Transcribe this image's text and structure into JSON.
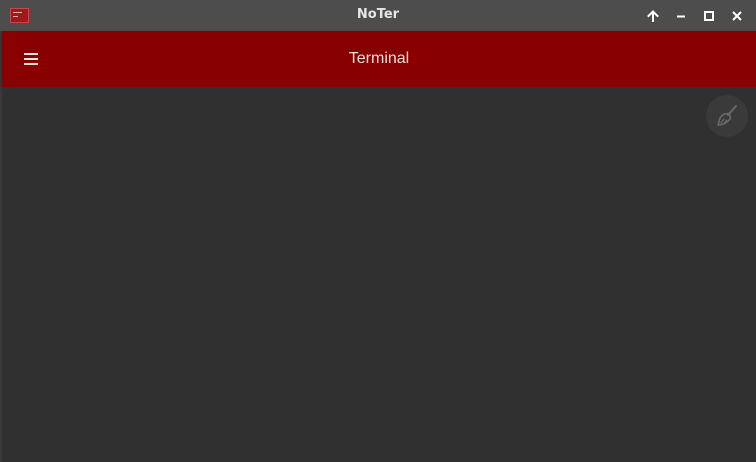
{
  "window": {
    "title": "NoTer",
    "controls": [
      "move-up",
      "minimize",
      "maximize",
      "close"
    ]
  },
  "appbar": {
    "title": "Terminal",
    "background": "#880000",
    "menu_icon": "hamburger-menu-icon"
  },
  "content": {
    "background": "#303030",
    "clear_icon": "broom-icon"
  }
}
